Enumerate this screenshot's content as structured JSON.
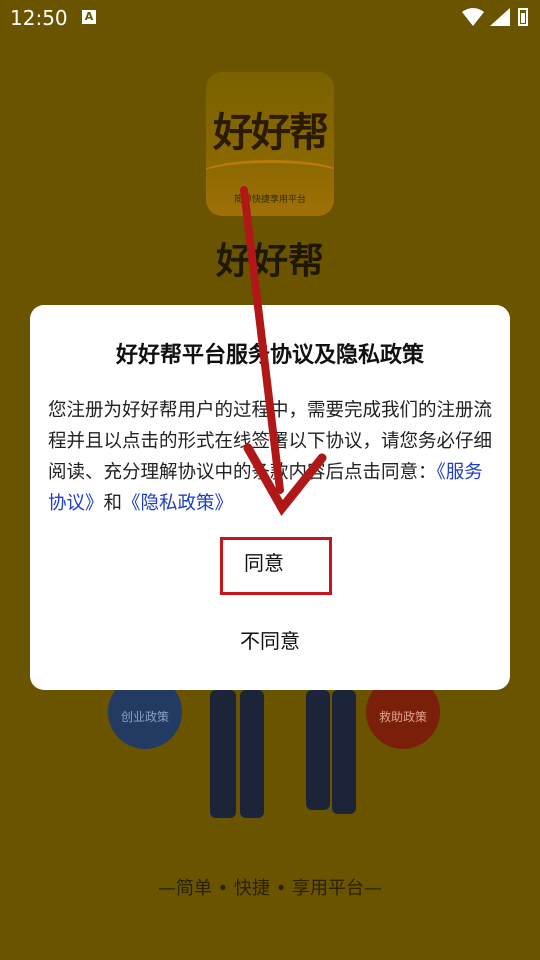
{
  "status_bar": {
    "time": "12:50",
    "notif_icon": "A"
  },
  "app": {
    "logo_text": "好好帮",
    "logo_subtitle": "简单快捷享用平台",
    "name": "好好帮"
  },
  "background_badges": {
    "left": "创业政策",
    "right": "救助政策"
  },
  "tagline": "—简单 • 快捷 • 享用平台—",
  "dialog": {
    "title": "好好帮平台服务协议及隐私政策",
    "body_text": "您注册为好好帮用户的过程中，需要完成我们的注册流程并且以点击的形式在线签署以下协议，请您务必仔细阅读、充分理解协议中的条款内容后点击同意：",
    "link_service": "《服务协议》",
    "conjunction": "和",
    "link_privacy": "《隐私政策》",
    "agree_label": "同意",
    "disagree_label": "不同意"
  },
  "colors": {
    "overlay_bg": "#6b5400",
    "link": "#1e3fc7",
    "highlight": "#c4161c"
  }
}
